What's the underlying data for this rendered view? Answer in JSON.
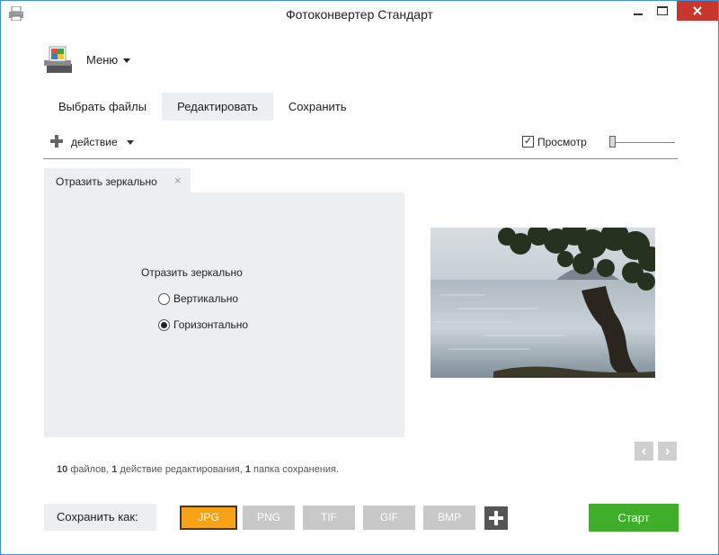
{
  "window": {
    "title": "Фотоконвертер Стандарт",
    "icon": "printer-app-icon",
    "minimize_icon": "minimize-icon",
    "maximize_icon": "maximize-icon",
    "close_icon": "close-icon",
    "close_color": "#c7372e"
  },
  "menu": {
    "label": "Меню",
    "icon": "app-logo-icon"
  },
  "tabs": [
    {
      "label": "Выбрать файлы",
      "active": false
    },
    {
      "label": "Редактировать",
      "active": true
    },
    {
      "label": "Сохранить",
      "active": false
    }
  ],
  "toolbar": {
    "action_label": "действие",
    "preview_label": "Просмотр",
    "preview_checked": "✓",
    "preview_checked_state": true,
    "zoom_level": 0
  },
  "editor": {
    "tab_label": "Отразить зеркально",
    "tab_close": "×",
    "heading": "Отразить зеркально",
    "options": [
      {
        "label": "Вертикально",
        "checked": false
      },
      {
        "label": "Горизонтально",
        "checked": true
      }
    ]
  },
  "preview": {
    "image": "tree-by-sea-photo"
  },
  "nav": {
    "prev": "‹",
    "next": "›"
  },
  "summary": {
    "files_count": "10",
    "files_text": "файлов,",
    "actions_count": "1",
    "actions_text": "действие редактирования,",
    "folders_count": "1",
    "folders_text": "папка сохранения."
  },
  "save": {
    "label": "Сохранить как:",
    "formats": [
      "JPG",
      "PNG",
      "TIF",
      "GIF",
      "BMP"
    ],
    "selected": "JPG",
    "accent": "#f7a117"
  },
  "start": {
    "label": "Старт",
    "color": "#3fae2a"
  }
}
